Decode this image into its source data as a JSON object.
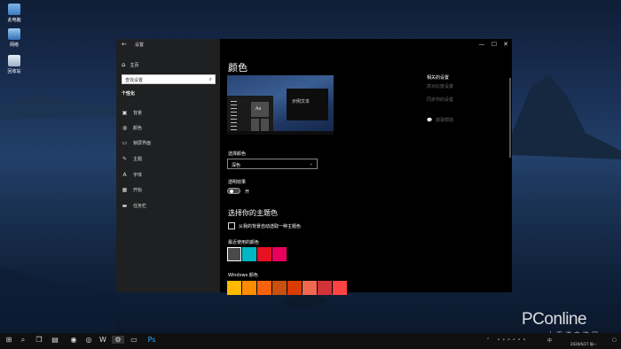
{
  "desktop": {
    "icons": [
      {
        "label": "此电脑",
        "icon": "computer-icon"
      },
      {
        "label": "网络",
        "icon": "network-icon"
      },
      {
        "label": "回收站",
        "icon": "recycle-bin-icon"
      }
    ]
  },
  "window": {
    "title": "设置",
    "back_glyph": "←",
    "min_glyph": "—",
    "max_glyph": "☐",
    "close_glyph": "✕"
  },
  "sidebar": {
    "home_label": "主页",
    "search_placeholder": "查找设置",
    "section": "个性化",
    "items": [
      {
        "label": "背景",
        "icon": "background-image-icon",
        "glyph": "▣"
      },
      {
        "label": "颜色",
        "icon": "palette-icon",
        "glyph": "◍"
      },
      {
        "label": "锁屏界面",
        "icon": "lock-screen-icon",
        "glyph": "▭"
      },
      {
        "label": "主题",
        "icon": "theme-brush-icon",
        "glyph": "✎"
      },
      {
        "label": "字体",
        "icon": "font-icon",
        "glyph": "A"
      },
      {
        "label": "开始",
        "icon": "start-icon",
        "glyph": "▦"
      },
      {
        "label": "任务栏",
        "icon": "taskbar-icon",
        "glyph": "▬"
      }
    ]
  },
  "content": {
    "page_title": "颜色",
    "preview_tile": "Aa",
    "preview_window_text": "示例文本",
    "choose_color_label": "选择颜色",
    "choose_color_value": "深色",
    "transparency_label": "透明效果",
    "transparency_state": "开",
    "accent_heading": "选择你的主题色",
    "auto_accent_label": "从我的背景自动选取一种主题色",
    "recent_colors_label": "最近使用的颜色",
    "recent_colors": [
      "#4a4a4a",
      "#00b7c3",
      "#e81123",
      "#ea005e"
    ],
    "windows_colors_label": "Windows 颜色",
    "windows_colors": [
      "#ffb900",
      "#ff8c00",
      "#f7630c",
      "#ca5010",
      "#da3b01",
      "#ef6950",
      "#d13438",
      "#ff4343"
    ]
  },
  "related": {
    "heading": "相关的设置",
    "links": [
      "高对比度设置",
      "同步你的设置"
    ],
    "help_label": "获取帮助"
  },
  "taskbar": {
    "time": "",
    "date": "2020/6/27 周一",
    "lang": "中"
  },
  "watermark": {
    "brand": "PConline",
    "sub": "太平洋电脑网"
  }
}
